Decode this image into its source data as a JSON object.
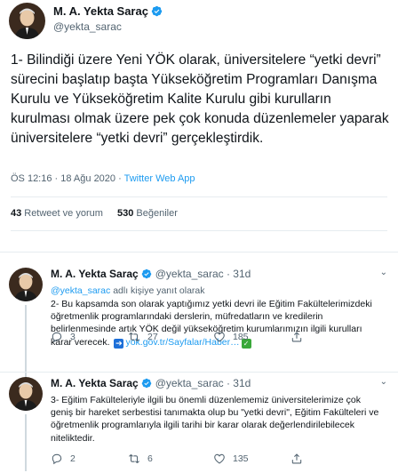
{
  "main": {
    "name": "M. A. Yekta Saraç",
    "handle": "@yekta_sarac",
    "text": "1- Bilindiği üzere Yeni YÖK olarak, üniversitelere “yetki devri” sürecini başlatıp başta Yükseköğretim Programları Danışma Kurulu ve Yükseköğretim Kalite Kurulu gibi kurulların kurulması olmak üzere pek çok konuda düzenlemeler yaparak üniversitelere “yetki devri” gerçekleştirdik.",
    "time": "ÖS 12:16 · 18 Ağu 2020 · ",
    "source": "Twitter Web App",
    "retweets_count": "43",
    "retweets_label": "Retweet ve yorum",
    "likes_count": "530",
    "likes_label": "Beğeniler"
  },
  "replies": [
    {
      "name": "M. A. Yekta Saraç",
      "handle": "@yekta_sarac · 31d",
      "replying_mention": "@yekta_sarac",
      "replying_suffix": " adlı kişiye yanıt olarak",
      "text": "2- Bu kapsamda son olarak yaptığımız yetki devri ile Eğitim Fakültelerimizdeki öğretmenlik programlarındaki derslerin, müfredatların ve kredilerin belirlenmesinde artık YÖK değil yükseköğretim kurumlarımızın ilgili kurulları karar verecek.",
      "link": "yok.gov.tr/Sayfalar/Haber…",
      "replies": "3",
      "retweets": "27",
      "likes": "185"
    },
    {
      "name": "M. A. Yekta Saraç",
      "handle": "@yekta_sarac · 31d",
      "text": "3- Eğitim Fakülteleriyle ilgili bu önemli düzenlememiz üniversitelerimize çok geniş bir hareket serbestisi tanımakta olup bu \"yetki devri\", Eğitim Fakülteleri ve öğretmenlik programlarıyla ilgili tarihi bir karar olarak değerlendirilebilecek niteliktedir.",
      "replies": "2",
      "retweets": "6",
      "likes": "135"
    }
  ],
  "colors": {
    "accent": "#1d9bf0",
    "text": "#0f1419",
    "muted": "#536471"
  },
  "icons": [
    "verified-icon",
    "reply-icon",
    "retweet-icon",
    "like-icon",
    "share-icon",
    "link-arrow-icon",
    "check-mark-icon",
    "chevron-down-icon"
  ]
}
